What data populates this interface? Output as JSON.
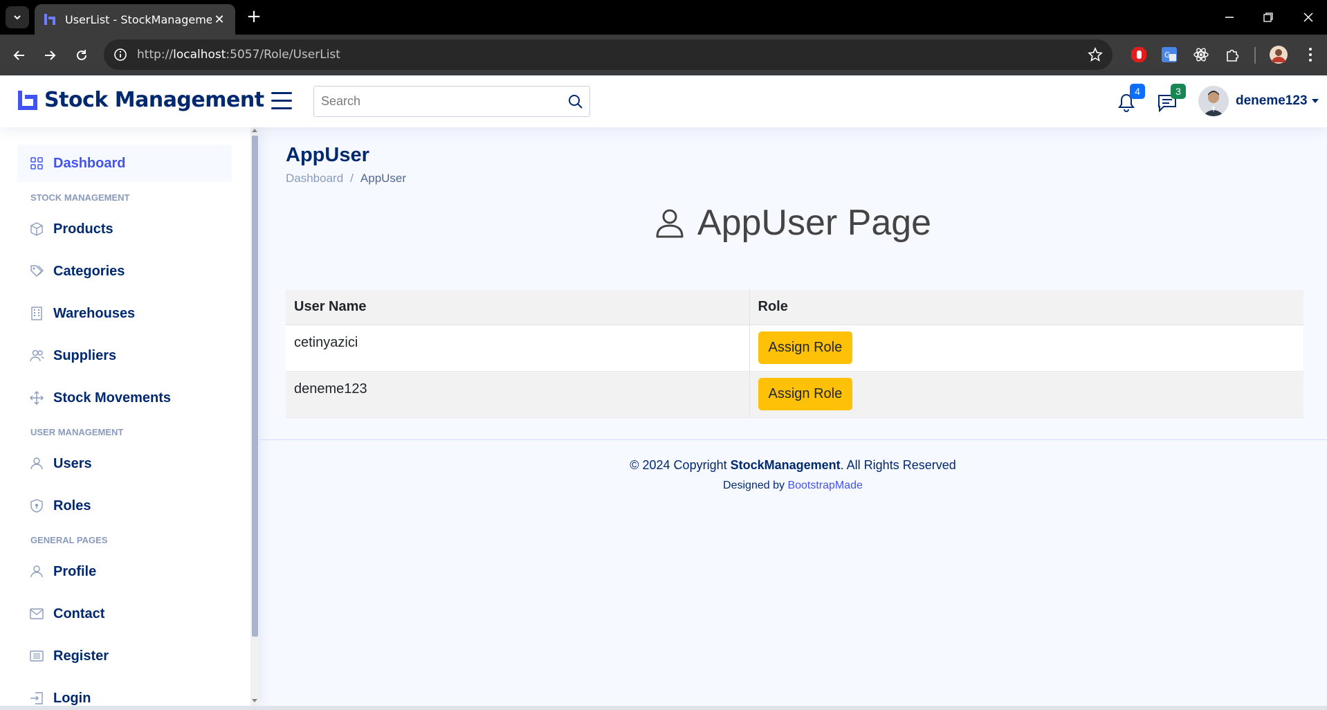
{
  "browser": {
    "tab_title": "UserList - StockManagement",
    "url_prefix": "http://",
    "url_host": "localhost",
    "url_rest": ":5057/Role/UserList"
  },
  "header": {
    "logo_text": "Stock Management",
    "search_placeholder": "Search",
    "notifications_count": "4",
    "messages_count": "3",
    "profile_name": "deneme123",
    "colors": {
      "primary": "#4154f1",
      "navy": "#012970",
      "notif_badge": "#0d6efd",
      "msg_badge": "#198754"
    }
  },
  "sidebar": {
    "dashboard": "Dashboard",
    "heading_stock": "STOCK MANAGEMENT",
    "products": "Products",
    "categories": "Categories",
    "warehouses": "Warehouses",
    "suppliers": "Suppliers",
    "stock_movements": "Stock Movements",
    "heading_user": "USER MANAGEMENT",
    "users": "Users",
    "roles": "Roles",
    "heading_general": "GENERAL PAGES",
    "profile": "Profile",
    "contact": "Contact",
    "register": "Register",
    "login": "Login"
  },
  "main": {
    "page_title": "AppUser",
    "breadcrumb_home": "Dashboard",
    "breadcrumb_current": "AppUser",
    "hero_title": "AppUser Page",
    "table": {
      "col_username": "User Name",
      "col_role": "Role",
      "rows": [
        {
          "username": "cetinyazici",
          "action": "Assign Role"
        },
        {
          "username": "deneme123",
          "action": "Assign Role"
        }
      ]
    },
    "button_color": "#ffc107"
  },
  "footer": {
    "copyright_prefix": "© 2024 Copyright ",
    "copyright_brand": "StockManagement",
    "copyright_suffix": ". All Rights Reserved",
    "designed_by": "Designed by ",
    "designer": "BootstrapMade"
  }
}
